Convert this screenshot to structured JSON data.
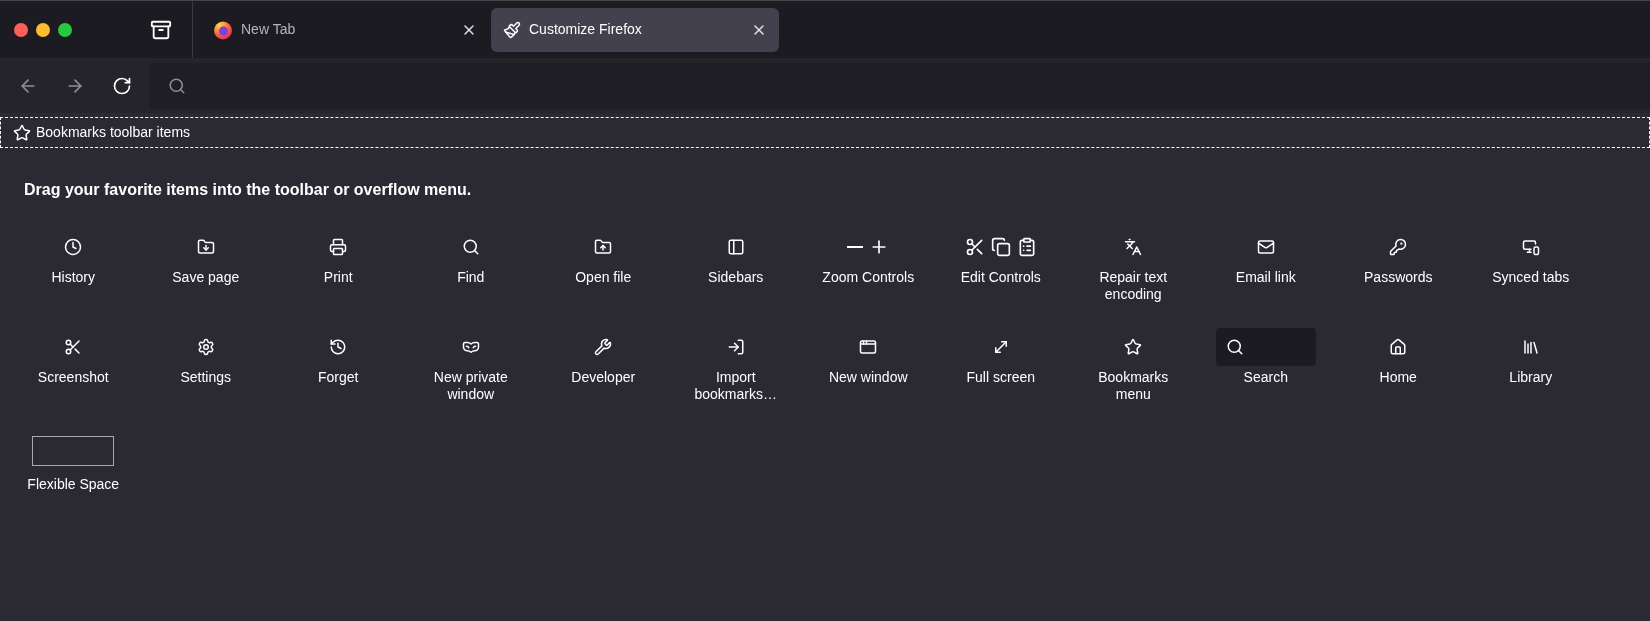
{
  "tabs": [
    {
      "label": "New Tab",
      "selected": false,
      "kind": "newtab"
    },
    {
      "label": "Customize Firefox",
      "selected": true,
      "kind": "customize"
    }
  ],
  "bookmarks_toolbar": {
    "label": "Bookmarks toolbar items"
  },
  "palette": {
    "heading": "Drag your favorite items into the toolbar or overflow menu.",
    "items": [
      {
        "label": "History",
        "kind": "button"
      },
      {
        "label": "Save page",
        "kind": "button"
      },
      {
        "label": "Print",
        "kind": "button"
      },
      {
        "label": "Find",
        "kind": "button"
      },
      {
        "label": "Open file",
        "kind": "button"
      },
      {
        "label": "Sidebars",
        "kind": "button"
      },
      {
        "label": "Zoom Controls",
        "kind": "button"
      },
      {
        "label": "Edit Controls",
        "kind": "button"
      },
      {
        "label": "Repair text encoding",
        "kind": "button"
      },
      {
        "label": "Email link",
        "kind": "button"
      },
      {
        "label": "Passwords",
        "kind": "button"
      },
      {
        "label": "Synced tabs",
        "kind": "button"
      },
      {
        "label": "Screenshot",
        "kind": "button"
      },
      {
        "label": "Settings",
        "kind": "button"
      },
      {
        "label": "Forget",
        "kind": "button"
      },
      {
        "label": "New private window",
        "kind": "button"
      },
      {
        "label": "Developer",
        "kind": "button"
      },
      {
        "label": "Import bookmarks…",
        "kind": "button"
      },
      {
        "label": "New window",
        "kind": "button"
      },
      {
        "label": "Full screen",
        "kind": "button"
      },
      {
        "label": "Bookmarks menu",
        "kind": "button"
      },
      {
        "label": "Search",
        "kind": "search"
      },
      {
        "label": "Home",
        "kind": "button"
      },
      {
        "label": "Library",
        "kind": "button"
      },
      {
        "label": "Flexible Space",
        "kind": "spacer"
      }
    ]
  }
}
